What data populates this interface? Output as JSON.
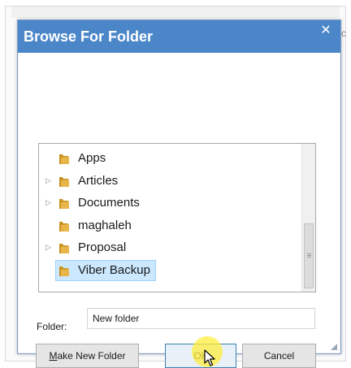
{
  "dialog": {
    "title": "Browse For Folder",
    "close_glyph": "✕"
  },
  "tree": {
    "items": [
      {
        "label": "Apps",
        "expandable": false,
        "selected": false
      },
      {
        "label": "Articles",
        "expandable": true,
        "selected": false
      },
      {
        "label": "Documents",
        "expandable": true,
        "selected": false
      },
      {
        "label": "maghaleh",
        "expandable": false,
        "selected": false
      },
      {
        "label": "Proposal",
        "expandable": true,
        "selected": false
      },
      {
        "label": "Viber Backup",
        "expandable": false,
        "selected": true
      }
    ],
    "expander_glyph": "▷"
  },
  "folder_field": {
    "label": "Folder:",
    "value": "New folder"
  },
  "buttons": {
    "make_new_folder_mnemonic": "M",
    "make_new_folder_rest": "ake New Folder",
    "ok": "OK",
    "cancel": "Cancel"
  },
  "background": {
    "right_edge_text": "c"
  },
  "colors": {
    "titlebar": "#4a86c8",
    "selection_fill": "#cce8ff",
    "selection_border": "#99d1ff",
    "folder_icon": "#e8b54b",
    "cursor_highlight": "#ffee3c"
  },
  "icons": {
    "folder": "folder-icon",
    "expander": "expand-arrow-icon",
    "close": "close-icon",
    "cursor": "mouse-pointer-icon",
    "resize": "resize-grip-icon"
  }
}
